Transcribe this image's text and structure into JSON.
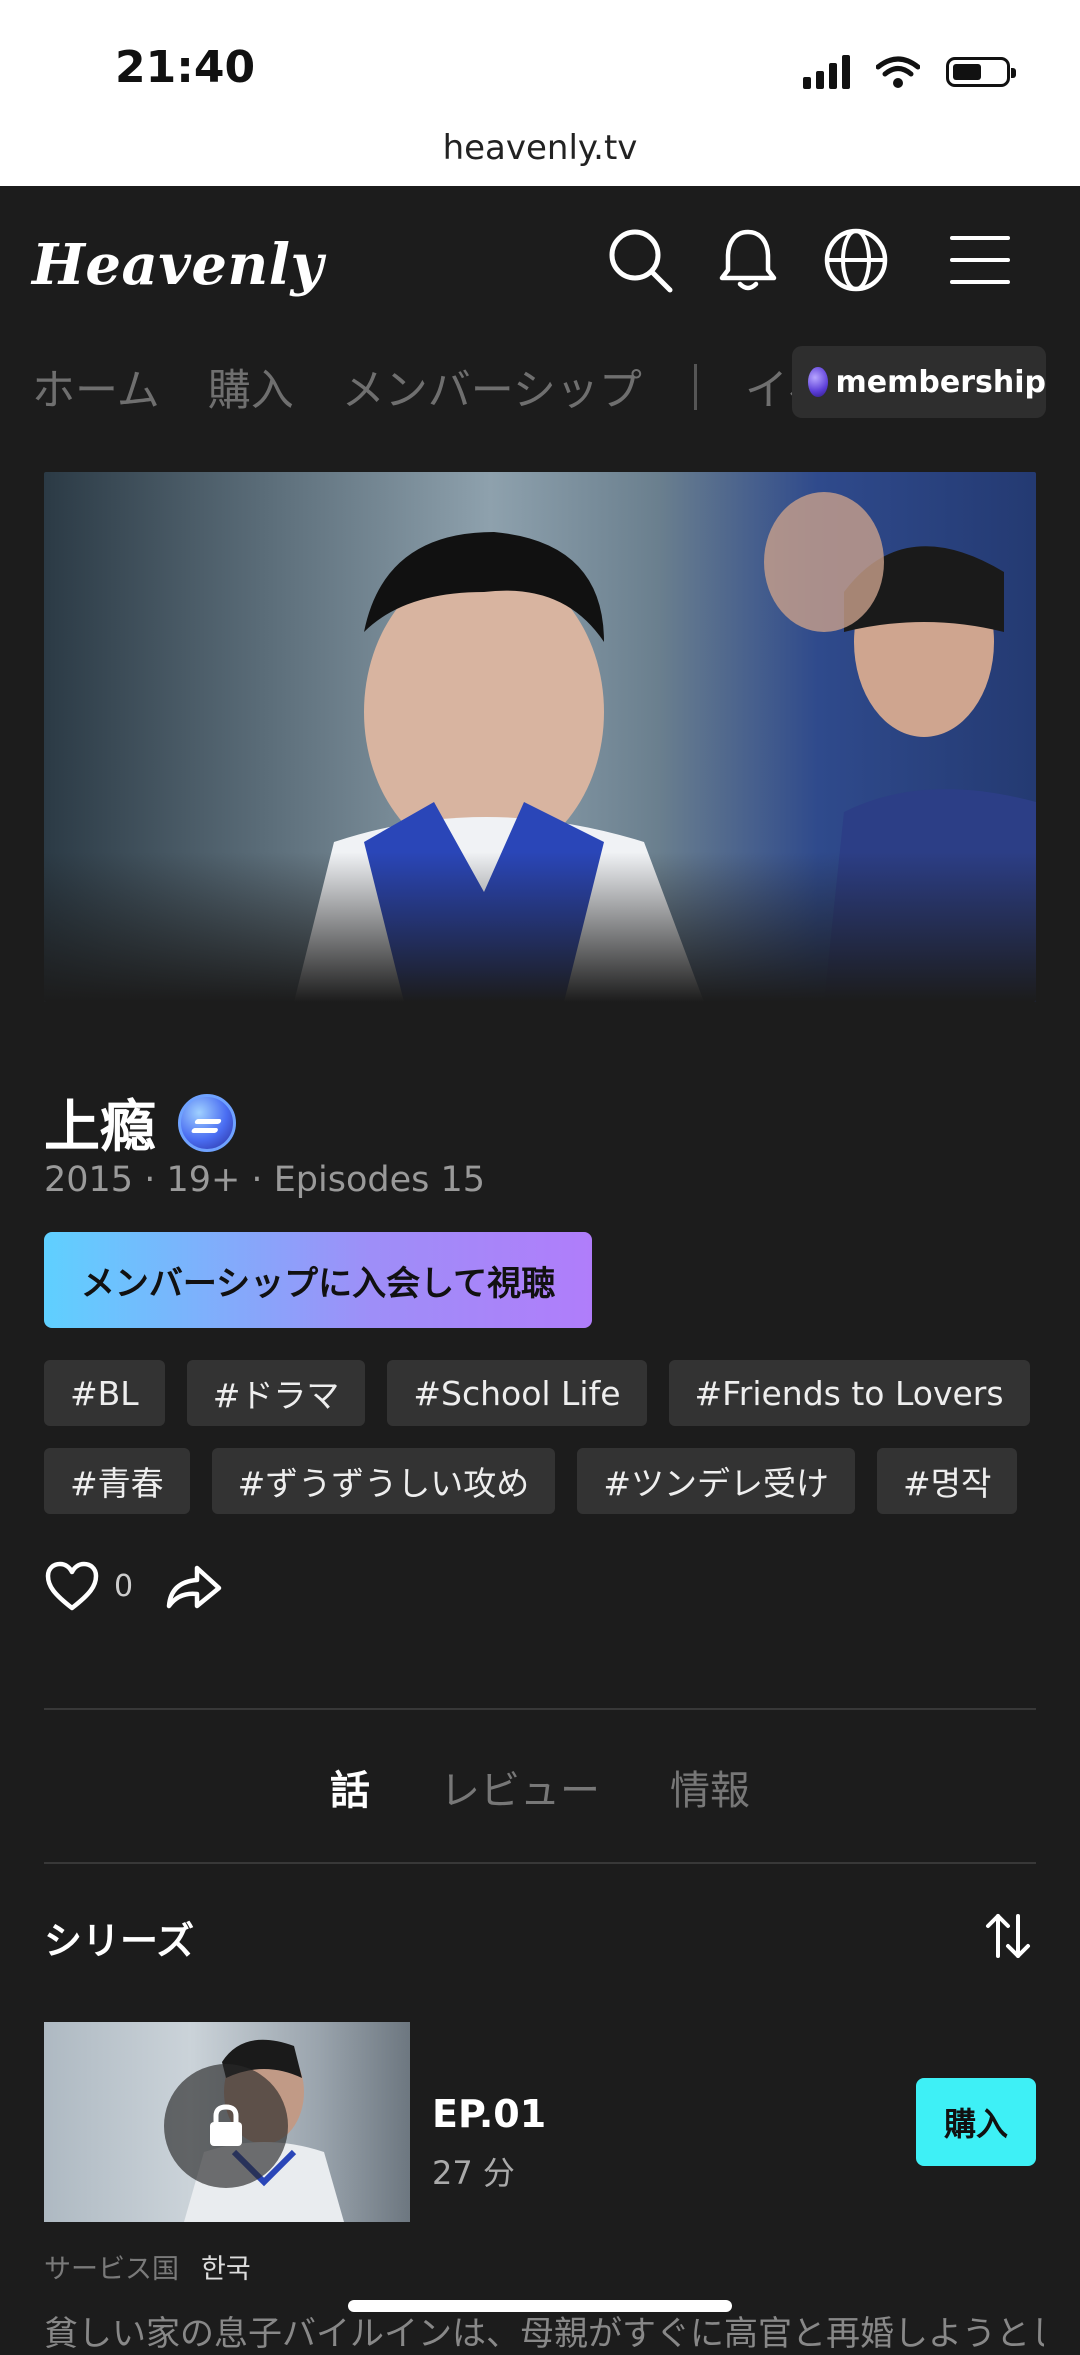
{
  "status_bar": {
    "time": "21:40",
    "url": "heavenly.tv"
  },
  "header": {
    "logo": "Heavenly",
    "icons": [
      "search-icon",
      "bell-icon",
      "globe-icon",
      "menu-icon"
    ],
    "nav": [
      "ホーム",
      "購入",
      "メンバーシップ",
      "イベント"
    ],
    "membership_pill": "membership"
  },
  "show": {
    "title": "上瘾",
    "meta": "2015 · 19+ · Episodes 15",
    "cta": "メンバーシップに入会して視聴",
    "tags_row1": [
      "#BL",
      "#ドラマ",
      "#School Life",
      "#Friends to Lovers"
    ],
    "tags_row2": [
      "#青春",
      "#ずうずうしい攻め",
      "#ツンデレ受け",
      "#명작"
    ],
    "like_count": "0"
  },
  "tabs": [
    "話",
    "レビュー",
    "情報"
  ],
  "series": {
    "heading": "シリーズ",
    "episode": {
      "title": "EP.01",
      "duration": "27 分",
      "buy_label": "購入"
    },
    "service_label": "サービス国",
    "service_value": "한국",
    "description": "貧しい家の息子バイルインは、母親がすぐに高官と再婚しようとしてい"
  },
  "colors": {
    "background": "#1c1c1c",
    "buy_button": "#3ef0f6",
    "cta_start": "#5fd0ff",
    "cta_end": "#b07dfa"
  }
}
